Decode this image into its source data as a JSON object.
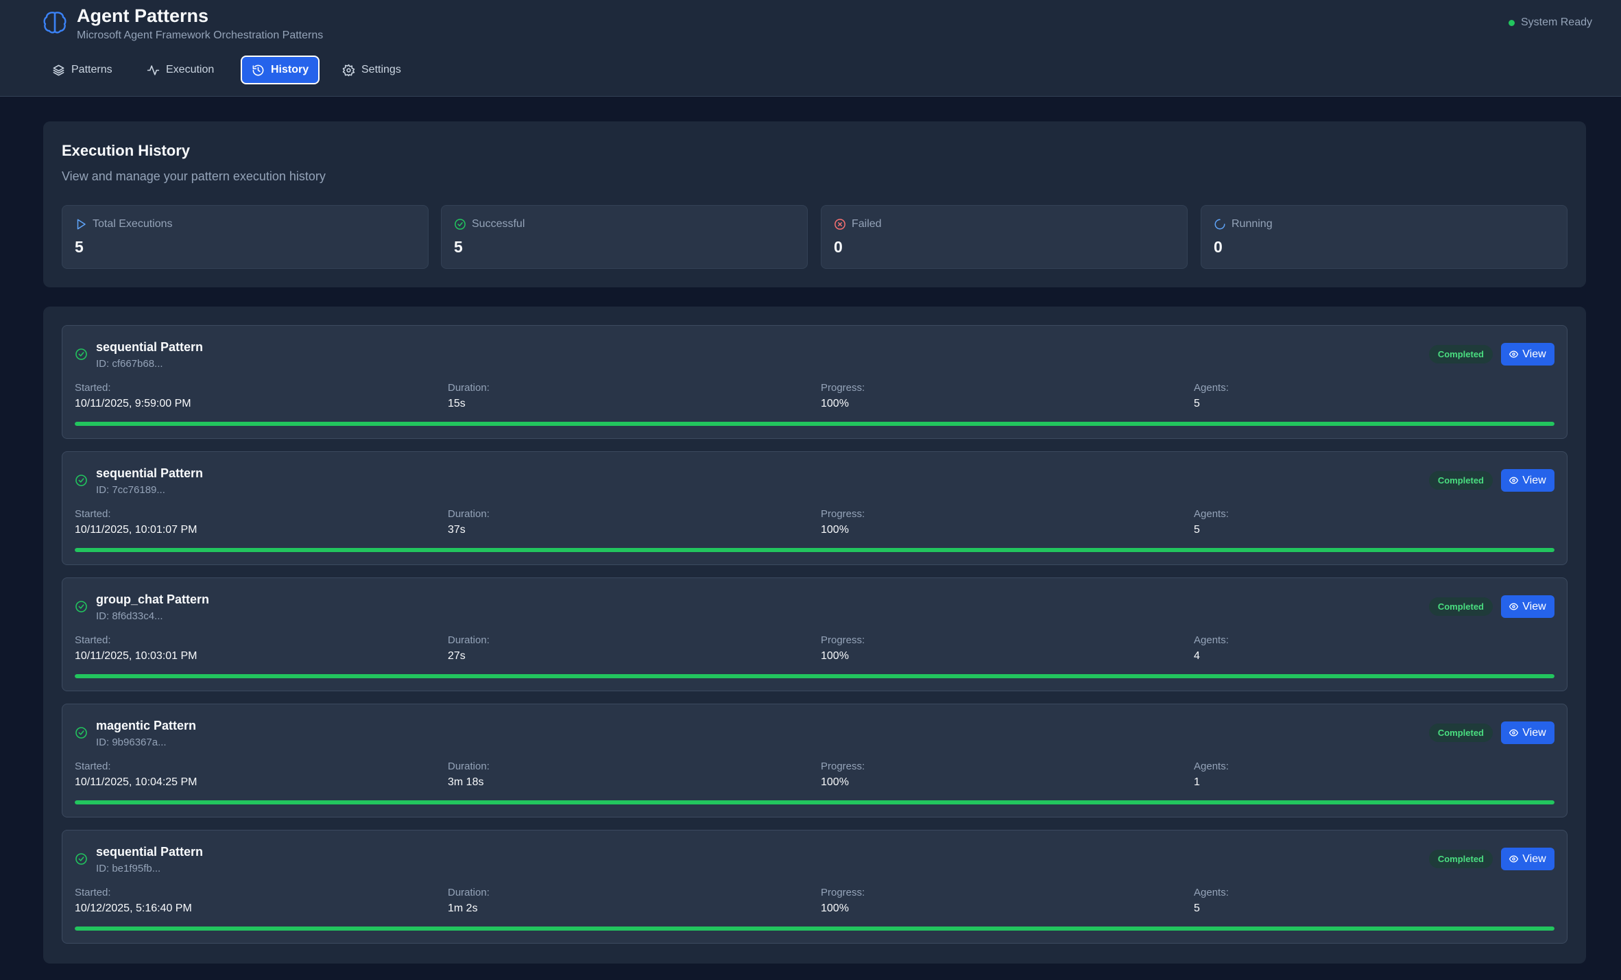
{
  "app": {
    "title": "Agent Patterns",
    "subtitle": "Microsoft Agent Framework Orchestration Patterns",
    "status": "System Ready"
  },
  "nav": {
    "tabs": [
      {
        "label": "Patterns",
        "icon": "layers-icon"
      },
      {
        "label": "Execution",
        "icon": "activity-icon"
      },
      {
        "label": "History",
        "icon": "history-icon",
        "active": true
      },
      {
        "label": "Settings",
        "icon": "gear-icon"
      }
    ]
  },
  "summary": {
    "title": "Execution History",
    "description": "View and manage your pattern execution history",
    "stats": [
      {
        "label": "Total Executions",
        "value": "5",
        "icon": "play-icon"
      },
      {
        "label": "Successful",
        "value": "5",
        "icon": "check-circle-icon"
      },
      {
        "label": "Failed",
        "value": "0",
        "icon": "x-circle-icon"
      },
      {
        "label": "Running",
        "value": "0",
        "icon": "spinner-icon"
      }
    ]
  },
  "history": {
    "labels": {
      "started": "Started:",
      "duration": "Duration:",
      "progress": "Progress:",
      "agents": "Agents:",
      "view": "View"
    },
    "runs": [
      {
        "name": "sequential Pattern",
        "id": "ID: cf667b68...",
        "status": "Completed",
        "started": "10/11/2025, 9:59:00 PM",
        "duration": "15s",
        "progress": "100%",
        "agents": "5",
        "progress_value": 100
      },
      {
        "name": "sequential Pattern",
        "id": "ID: 7cc76189...",
        "status": "Completed",
        "started": "10/11/2025, 10:01:07 PM",
        "duration": "37s",
        "progress": "100%",
        "agents": "5",
        "progress_value": 100
      },
      {
        "name": "group_chat Pattern",
        "id": "ID: 8f6d33c4...",
        "status": "Completed",
        "started": "10/11/2025, 10:03:01 PM",
        "duration": "27s",
        "progress": "100%",
        "agents": "4",
        "progress_value": 100
      },
      {
        "name": "magentic Pattern",
        "id": "ID: 9b96367a...",
        "status": "Completed",
        "started": "10/11/2025, 10:04:25 PM",
        "duration": "3m 18s",
        "progress": "100%",
        "agents": "1",
        "progress_value": 100
      },
      {
        "name": "sequential Pattern",
        "id": "ID: be1f95fb...",
        "status": "Completed",
        "started": "10/12/2025, 5:16:40 PM",
        "duration": "1m 2s",
        "progress": "100%",
        "agents": "5",
        "progress_value": 100
      }
    ]
  },
  "colors": {
    "accent": "#2563eb",
    "success": "#22c55e",
    "danger": "#f87171",
    "info": "#60a5fa"
  }
}
